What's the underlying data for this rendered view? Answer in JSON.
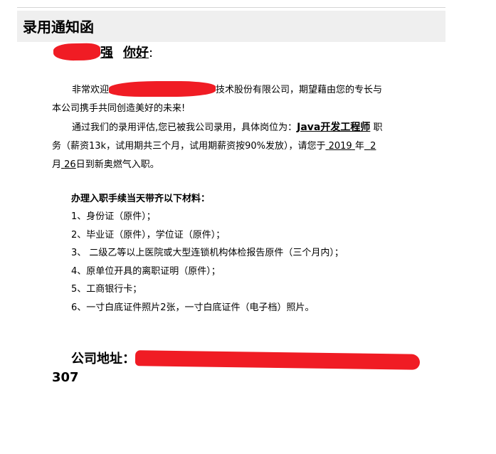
{
  "header": {
    "title": "录用通知函"
  },
  "greeting": {
    "name_tail": "强",
    "hello": "你好",
    "colon": ":"
  },
  "paragraph1": {
    "start": "非常欢迎",
    "company_tail": "技术股份有限公司，期望藉由您的专长与本公司携手共同创造美好的未来!"
  },
  "paragraph2": {
    "intro": "通过我们的录用评估,您已被我公司录用，具体岗位为：",
    "position": "Java开发工程师",
    "after_position": "职务（薪资13k，试用期共三个月，试用期薪资按90%发放），请您于",
    "year": "2019",
    "year_unit": "年",
    "month": "2",
    "month_unit": "月",
    "day": "26",
    "day_suffix": "日到新奥燃气入职。"
  },
  "materials": {
    "title": "办理入职手续当天带齐以下材料：",
    "items": [
      "1、身份证（原件）；",
      "2、毕业证（原件），学位证（原件）；",
      "3、 二级乙等以上医院或大型连锁机构体检报告原件（三个月内）；",
      "4、原单位开具的离职证明（原件）；",
      "5、工商银行卡；",
      "6、一寸白底证件照片2张，一寸白底证件（电子档）照片。"
    ]
  },
  "address": {
    "label": "公司地址：",
    "tail": "307"
  },
  "colors": {
    "redaction": "#f01c24",
    "header_bg": "#efefef"
  }
}
